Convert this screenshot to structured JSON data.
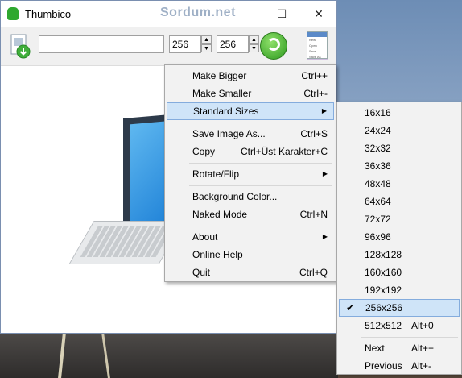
{
  "window": {
    "title": "Thumbico",
    "watermark": "Sordum.net",
    "min_glyph": "—",
    "max_glyph": "☐",
    "close_glyph": "✕"
  },
  "toolbar": {
    "path_value": "",
    "width_value": "256",
    "height_value": "256",
    "up_glyph": "▲",
    "down_glyph": "▼",
    "doc_lines": [
      "New",
      "Open",
      "Save",
      "Save As"
    ]
  },
  "main_menu": [
    {
      "label": "Make Bigger",
      "shortcut": "Ctrl++"
    },
    {
      "label": "Make Smaller",
      "shortcut": "Ctrl+-"
    },
    {
      "label": "Standard Sizes",
      "shortcut": "",
      "submenu": true,
      "highlighted": true
    },
    {
      "label": "Save Image As...",
      "shortcut": "Ctrl+S"
    },
    {
      "label": "Copy",
      "shortcut": "Ctrl+Üst Karakter+C"
    },
    {
      "label": "Rotate/Flip",
      "shortcut": "",
      "submenu": true
    },
    {
      "label": "Background Color...",
      "shortcut": ""
    },
    {
      "label": "Naked Mode",
      "shortcut": "Ctrl+N"
    },
    {
      "label": "About",
      "shortcut": "",
      "submenu": true
    },
    {
      "label": "Online Help",
      "shortcut": ""
    },
    {
      "label": "Quit",
      "shortcut": "Ctrl+Q"
    }
  ],
  "submenu_arrow": "▶",
  "sizes_menu": [
    {
      "label": "16x16",
      "shortcut": ""
    },
    {
      "label": "24x24",
      "shortcut": ""
    },
    {
      "label": "32x32",
      "shortcut": ""
    },
    {
      "label": "36x36",
      "shortcut": ""
    },
    {
      "label": "48x48",
      "shortcut": ""
    },
    {
      "label": "64x64",
      "shortcut": ""
    },
    {
      "label": "72x72",
      "shortcut": ""
    },
    {
      "label": "96x96",
      "shortcut": ""
    },
    {
      "label": "128x128",
      "shortcut": ""
    },
    {
      "label": "160x160",
      "shortcut": ""
    },
    {
      "label": "192x192",
      "shortcut": ""
    },
    {
      "label": "256x256",
      "shortcut": "",
      "checked": true,
      "highlighted": true
    },
    {
      "label": "512x512",
      "shortcut": "Alt+0"
    },
    {
      "label": "Next",
      "shortcut": "Alt++"
    },
    {
      "label": "Previous",
      "shortcut": "Alt+-"
    }
  ],
  "check_glyph": "✔"
}
